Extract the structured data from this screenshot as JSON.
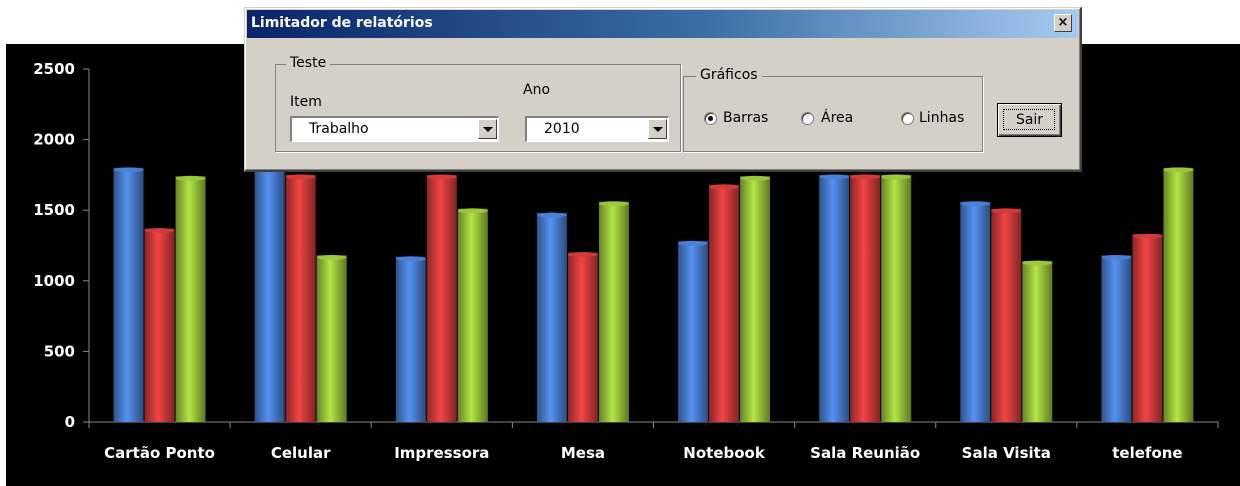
{
  "dialog": {
    "title": "Limitador de relatórios",
    "close_label": "×",
    "group_test_label": "Teste",
    "item_label": "Item",
    "item_value": "Trabalho",
    "year_label": "Ano",
    "year_value": "2010",
    "charts_group_label": "Gráficos",
    "radio_options": [
      {
        "label": "Barras",
        "selected": true
      },
      {
        "label": "Área",
        "selected": false
      },
      {
        "label": "Linhas",
        "selected": false
      }
    ],
    "exit_button_label": "Sair"
  },
  "chart_data": {
    "type": "bar",
    "categories": [
      "Cartão Ponto",
      "Celular",
      "Impressora",
      "Mesa",
      "Notebook",
      "Sala Reunião",
      "Sala Visita",
      "telefone"
    ],
    "series": [
      {
        "color": "#4a7fd4",
        "values": [
          1800,
          1800,
          1170,
          1480,
          1280,
          1750,
          1560,
          1180
        ]
      },
      {
        "color": "#d43c3c",
        "values": [
          1370,
          1750,
          1750,
          1200,
          1680,
          1750,
          1510,
          1330
        ]
      },
      {
        "color": "#9cc83c",
        "values": [
          1740,
          1180,
          1510,
          1560,
          1740,
          1750,
          1140,
          1800
        ]
      }
    ],
    "ylim": [
      0,
      2500
    ],
    "yticks": [
      "0",
      "500",
      "1000",
      "1500",
      "2000",
      "2500"
    ],
    "background": "#000000"
  }
}
